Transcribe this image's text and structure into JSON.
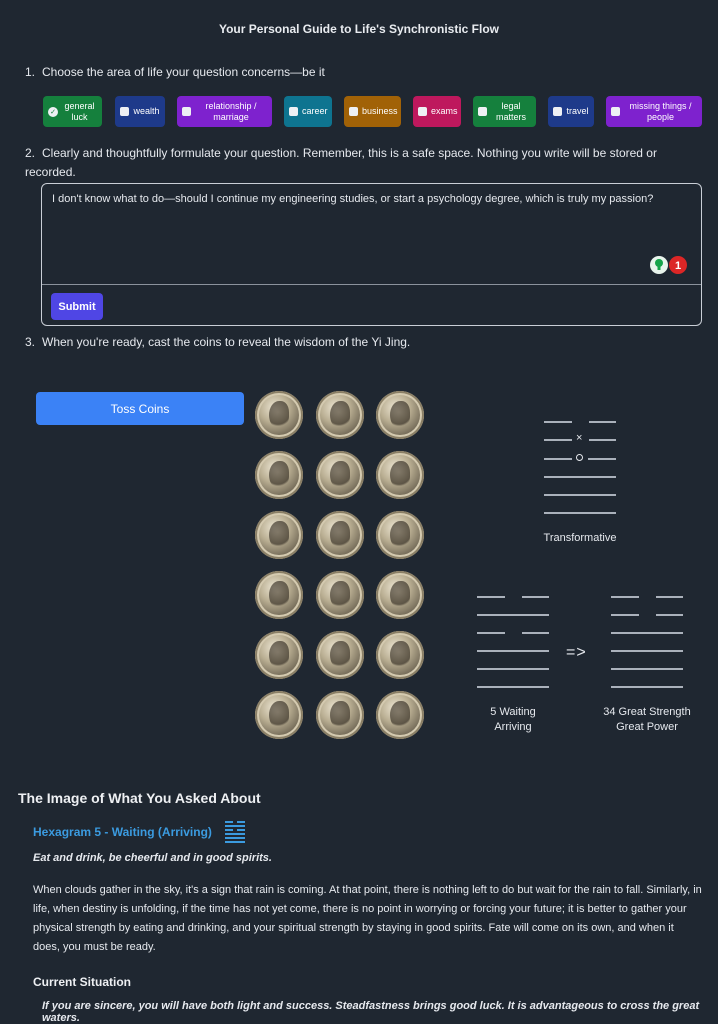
{
  "title": "Your Personal Guide to Life's Synchronistic Flow",
  "steps": {
    "s1_num": "1.",
    "s1_text": "Choose the area of life your question concerns—be it",
    "s2_num": "2.",
    "s2_text": "Clearly and thoughtfully formulate your question. Remember, this is a safe space. Nothing you write will be stored or recorded.",
    "s3_num": "3.",
    "s3_text": "When you're ready, cast the coins to reveal the wisdom of the Yi Jing."
  },
  "categories": [
    {
      "label": "general luck",
      "color": "#15803d",
      "checked": true
    },
    {
      "label": "wealth",
      "color": "#1e3a8a",
      "checked": false
    },
    {
      "label": "relationship / marriage",
      "color": "#7e22ce",
      "checked": false
    },
    {
      "label": "career",
      "color": "#0e7490",
      "checked": false
    },
    {
      "label": "business",
      "color": "#a16207",
      "checked": false
    },
    {
      "label": "exams",
      "color": "#be185d",
      "checked": false
    },
    {
      "label": "legal matters",
      "color": "#15803d",
      "checked": false
    },
    {
      "label": "travel",
      "color": "#1e3a8a",
      "checked": false
    },
    {
      "label": "missing things / people",
      "color": "#7e22ce",
      "checked": false
    }
  ],
  "question": {
    "value": "I don't know what to do—should I continue my engineering studies, or start a psychology degree, which is truly my passion?",
    "submit_label": "Submit",
    "badge_count": "1"
  },
  "toss_label": "Toss Coins",
  "primary_hex": {
    "label": "Transformative",
    "lines_top_to_bottom": [
      "yin",
      "yin-changing",
      "yang-changing",
      "yang",
      "yang",
      "yang"
    ]
  },
  "hex_from": {
    "name": "5 Waiting",
    "sub": "Arriving"
  },
  "arrow": "=>",
  "hex_to": {
    "name": "34 Great Strength",
    "sub": "Great Power"
  },
  "reading": {
    "heading": "The Image of What You Asked About",
    "hexagram_title": "Hexagram 5 - Waiting (Arriving)",
    "motto": "Eat and drink, be cheerful and in good spirits.",
    "paragraph": "When clouds gather in the sky, it's a sign that rain is coming. At that point, there is nothing left to do but wait for the rain to fall. Similarly, in life, when destiny is unfolding, if the time has not yet come, there is no point in worrying or forcing your future; it is better to gather your physical strength by eating and drinking, and your spiritual strength by staying in good spirits. Fate will come on its own, and when it does, you must be ready.",
    "current_heading": "Current Situation",
    "current_text": "If you are sincere, you will have both light and success. Steadfastness brings good luck. It is advantageous to cross the great waters."
  },
  "colors": {
    "background": "#1f2731",
    "accent": "#3b82f6",
    "submit": "#4f46e5",
    "link": "#3b9be0"
  }
}
